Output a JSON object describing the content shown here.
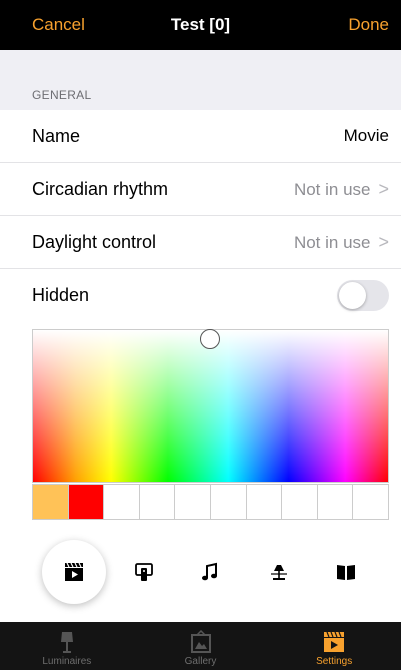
{
  "nav": {
    "cancel": "Cancel",
    "title": "Test [0]",
    "done": "Done",
    "accent": "#f7a12e"
  },
  "section": {
    "label": "GENERAL"
  },
  "rows": [
    {
      "label": "Name",
      "value": "Movie"
    },
    {
      "label": "Circadian rhythm",
      "value": "Not in use",
      "chevron": ">"
    },
    {
      "label": "Daylight control",
      "value": "Not in use",
      "chevron": ">"
    },
    {
      "label": "Hidden",
      "toggle": false
    }
  ],
  "swatches": [
    "#ffc257",
    "#ff0000",
    "#ffffff",
    "#ffffff",
    "#ffffff",
    "#ffffff",
    "#ffffff",
    "#ffffff",
    "#ffffff",
    "#ffffff"
  ],
  "modes": [
    {
      "icon": "clapperboard-icon",
      "selected": true
    },
    {
      "icon": "remote-icon"
    },
    {
      "icon": "music-note-icon"
    },
    {
      "icon": "table-lamp-icon"
    },
    {
      "icon": "book-icon"
    }
  ],
  "tabs": [
    {
      "label": "Luminaires",
      "icon": "floor-lamp-icon"
    },
    {
      "label": "Gallery",
      "icon": "picture-frame-icon"
    },
    {
      "label": "Settings",
      "icon": "clapperboard-icon",
      "active": true
    }
  ]
}
